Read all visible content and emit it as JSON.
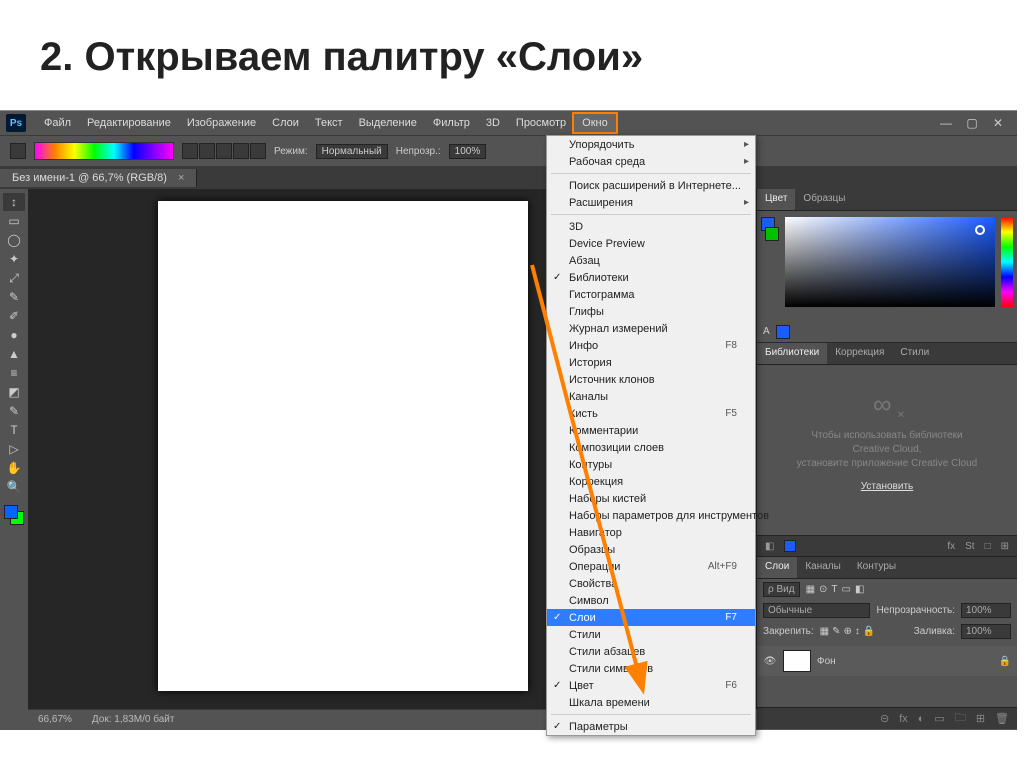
{
  "slide": {
    "title": "2. Открываем палитру «Слои»"
  },
  "app": {
    "logo": "Ps",
    "menu": [
      "Файл",
      "Редактирование",
      "Изображение",
      "Слои",
      "Текст",
      "Выделение",
      "Фильтр",
      "3D",
      "Просмотр",
      "Окно"
    ],
    "menu_highlight_index": 9,
    "window_buttons": [
      "—",
      "▢",
      "✕"
    ],
    "options": {
      "mode_label": "Режим:",
      "mode_value": "Нормальный",
      "opacity_label": "Непрозр.:",
      "opacity_value": "100%"
    },
    "document_tab": {
      "title": "Без имени-1 @ 66,7% (RGB/8)",
      "close": "×"
    },
    "tools": [
      "↕",
      "▭",
      "◯",
      "✦",
      "⤢",
      "✎",
      "✐",
      "●",
      "▲",
      "≡",
      "◩",
      "✎",
      "T",
      "▷",
      "✋",
      "🔍"
    ],
    "status": {
      "zoom": "66,67%",
      "doc": "Док: 1,83M/0 байт"
    }
  },
  "panels": {
    "color_tabs": [
      "Цвет",
      "Образцы"
    ],
    "color_readout_label": "A",
    "lib_tabs": [
      "Библиотеки",
      "Коррекция",
      "Стили"
    ],
    "lib_msg1": "Чтобы использовать библиотеки",
    "lib_msg2": "Creative Cloud,",
    "lib_msg3": "установите приложение Creative Cloud",
    "lib_link": "Установить",
    "strip_symbols": [
      "◧",
      "■",
      "fx",
      "St",
      "□",
      "⊞"
    ],
    "layers_tabs": [
      "Слои",
      "Каналы",
      "Контуры"
    ],
    "layers": {
      "kind_label": "ρ Вид",
      "icons": [
        "▦",
        "⊙",
        "T",
        "▭",
        "◧"
      ],
      "blend": "Обычные",
      "opacity_label": "Непрозрачность:",
      "opacity_val": "100%",
      "lock_label": "Закрепить:",
      "lock_icons": [
        "▦",
        "✎",
        "⊕",
        "↕",
        "🔒"
      ],
      "fill_label": "Заливка:",
      "fill_val": "100%",
      "layer_name": "Фон",
      "bottom_icons": [
        "⊝",
        "fx",
        "◐",
        "▭",
        "🗀",
        "⊞",
        "🗑"
      ]
    }
  },
  "dropdown": {
    "groups": [
      [
        {
          "label": "Упорядочить",
          "sub": true
        },
        {
          "label": "Рабочая среда",
          "sub": true
        }
      ],
      [
        {
          "label": "Поиск расширений в Интернете..."
        },
        {
          "label": "Расширения",
          "sub": true
        }
      ],
      [
        {
          "label": "3D"
        },
        {
          "label": "Device Preview"
        },
        {
          "label": "Абзац"
        },
        {
          "label": "Библиотеки",
          "checked": true
        },
        {
          "label": "Гистограмма"
        },
        {
          "label": "Глифы"
        },
        {
          "label": "Журнал измерений"
        },
        {
          "label": "Инфо",
          "shortcut": "F8"
        },
        {
          "label": "История"
        },
        {
          "label": "Источник клонов"
        },
        {
          "label": "Каналы"
        },
        {
          "label": "Кисть",
          "shortcut": "F5"
        },
        {
          "label": "Комментарии"
        },
        {
          "label": "Композиции слоев"
        },
        {
          "label": "Контуры"
        },
        {
          "label": "Коррекция"
        },
        {
          "label": "Наборы кистей"
        },
        {
          "label": "Наборы параметров для инструментов"
        },
        {
          "label": "Навигатор"
        },
        {
          "label": "Образцы"
        },
        {
          "label": "Операции",
          "shortcut": "Alt+F9"
        },
        {
          "label": "Свойства"
        },
        {
          "label": "Символ"
        },
        {
          "label": "Слои",
          "shortcut": "F7",
          "checked": true,
          "highlight": true
        },
        {
          "label": "Стили"
        },
        {
          "label": "Стили абзацев"
        },
        {
          "label": "Стили символов"
        },
        {
          "label": "Цвет",
          "shortcut": "F6",
          "checked": true
        },
        {
          "label": "Шкала времени"
        }
      ],
      [
        {
          "label": "Параметры",
          "checked": true
        }
      ]
    ]
  }
}
